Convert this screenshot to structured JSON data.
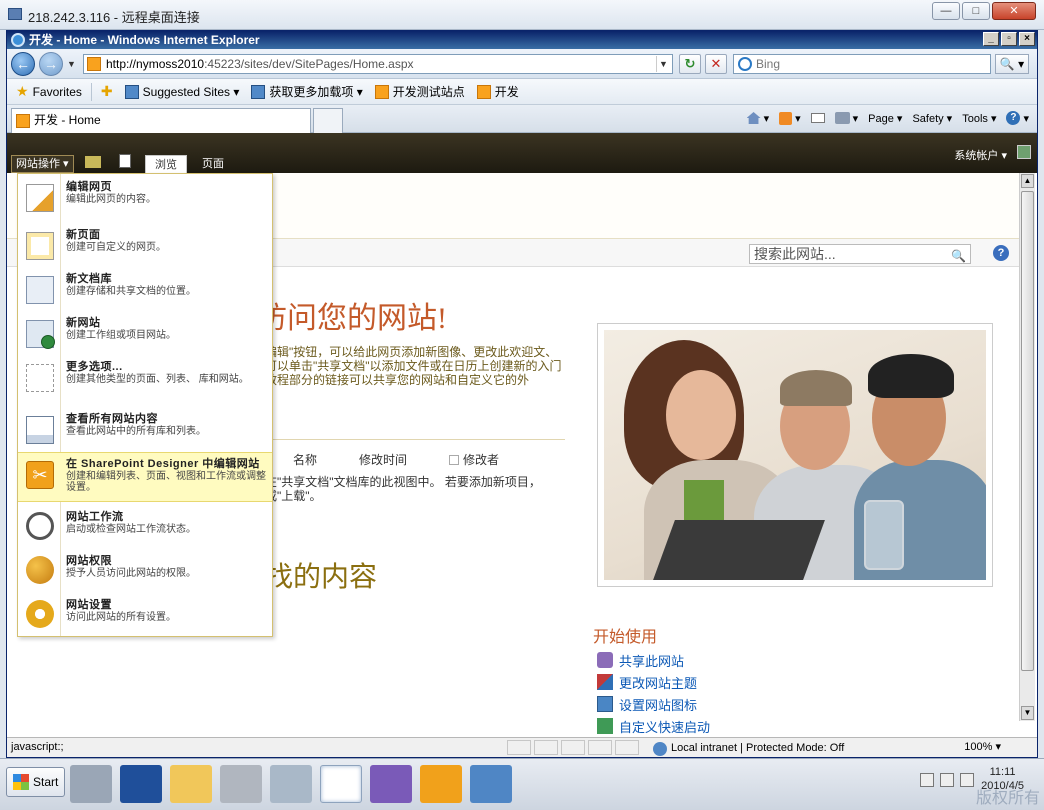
{
  "rdp": {
    "title": "218.242.3.116 - 远程桌面连接",
    "btn_min": "—",
    "btn_max": "□",
    "btn_close": "✕"
  },
  "ie": {
    "title": "开发 - Home - Windows Internet Explorer",
    "url_host": "http://nymoss2010",
    "url_rest": ":45223/sites/dev/SitePages/Home.aspx",
    "search_placeholder": "Bing",
    "favorites": [
      {
        "label": "Favorites"
      },
      {
        "label": "Suggested Sites ▾"
      },
      {
        "label": "获取更多加载项 ▾"
      },
      {
        "label": "开发测试站点"
      },
      {
        "label": "开发"
      }
    ],
    "tab_label": "开发 - Home",
    "cmd": {
      "page": "Page ▾",
      "safety": "Safety ▾",
      "tools": "Tools ▾"
    }
  },
  "sp": {
    "site_actions": "网站操作 ▾",
    "tab_browse": "浏览",
    "tab_page": "页面",
    "user": "系统帐户 ▾",
    "search_placeholder": "搜索此网站...",
    "welcome": "访问您的网站!",
    "intro": "编辑\"按钮，可以给此网页添加新图像、更改此欢迎文、可以单击\"共享文档\"以添加文件或在日历上创建新的入门教程部分的链接可以共享您的网站和自定义它的外",
    "col_name": "名称",
    "col_modified": "修改时间",
    "col_modified_by": "修改者",
    "empty_line1": "在\"共享文档\"文档库的此视图中。 若要添加新项目，",
    "empty_line2": "或\"上载\"。",
    "find_title": "找的内容",
    "getting_started": "开始使用",
    "gs_items": [
      "共享此网站",
      "更改网站主题",
      "设置网站图标",
      "自定义快速启动"
    ]
  },
  "menu": [
    {
      "title": "编辑网页",
      "desc": "编辑此网页的内容。"
    },
    {
      "title": "新页面",
      "desc": "创建可自定义的网页。"
    },
    {
      "title": "新文档库",
      "desc": "创建存储和共享文档的位置。"
    },
    {
      "title": "新网站",
      "desc": "创建工作组或项目网站。"
    },
    {
      "title": "更多选项...",
      "desc": "创建其他类型的页面、列表、 库和网站。"
    },
    {
      "title": "查看所有网站内容",
      "desc": "查看此网站中的所有库和列表。"
    },
    {
      "title": "在 SharePoint Designer 中编辑网站",
      "desc": "创建和编辑列表、页面、视图和工作流或调整设置。"
    },
    {
      "title": "网站工作流",
      "desc": "启动或检查网站工作流状态。"
    },
    {
      "title": "网站权限",
      "desc": "授予人员访问此网站的权限。"
    },
    {
      "title": "网站设置",
      "desc": "访问此网站的所有设置。"
    }
  ],
  "status": {
    "left": "javascript:;",
    "zone": "Local intranet | Protected Mode: Off",
    "zoom": "100% ▾"
  },
  "taskbar": {
    "start": "Start",
    "time": "11:11",
    "date": "2010/4/5",
    "watermark": "版权所有"
  }
}
